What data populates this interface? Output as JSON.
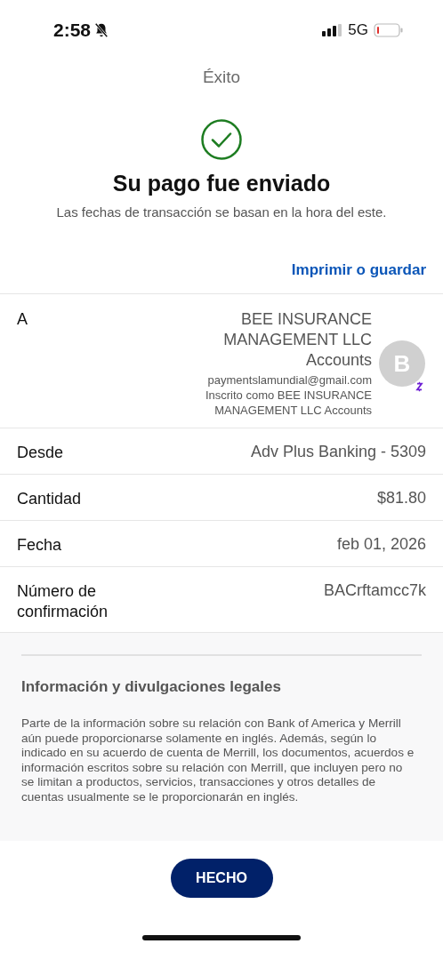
{
  "status_bar": {
    "time": "2:58",
    "network": "5G"
  },
  "header": {
    "title": "Éxito"
  },
  "confirmation": {
    "heading": "Su pago fue enviado",
    "subtitle": "Las fechas de transacción se basan en la hora del este."
  },
  "print_link": "Imprimir o guardar",
  "recipient": {
    "label": "A",
    "name": "BEE INSURANCE MANAGEMENT LLC Accounts",
    "email": "paymentslamundial@gmail.com",
    "enrolled_as": "Inscrito como BEE INSURANCE MANAGEMENT LLC Accounts",
    "avatar_initial": "B"
  },
  "details": [
    {
      "label": "Desde",
      "value": "Adv Plus Banking - 5309"
    },
    {
      "label": "Cantidad",
      "value": "$81.80"
    },
    {
      "label": "Fecha",
      "value": "feb 01, 2026"
    },
    {
      "label": "Número de confirmación",
      "value": "BACrftamcc7k"
    }
  ],
  "legal": {
    "heading": "Información y divulgaciones legales",
    "body": "Parte de la información sobre su relación con Bank of America y Merrill aún puede proporcionarse solamente en inglés. Además, según lo indicado en su acuerdo de cuenta de Merrill, los documentos, acuerdos e información escritos sobre su relación con Merrill, que incluyen pero no se limitan a productos, servicios, transacciones y otros detalles de cuentas usualmente se le proporcionarán en inglés."
  },
  "done_button": "HECHO"
}
